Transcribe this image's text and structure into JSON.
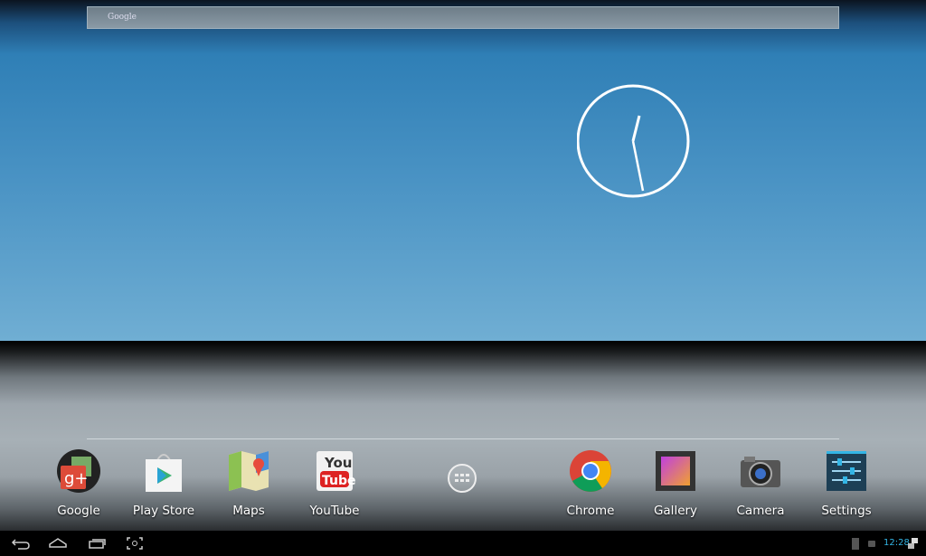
{
  "search": {
    "placeholder": "Google"
  },
  "clock": {
    "type": "analog",
    "time": "12:28"
  },
  "dock": {
    "apps": [
      {
        "label": "Google",
        "icon": "google-plus-icon"
      },
      {
        "label": "Play Store",
        "icon": "play-store-icon"
      },
      {
        "label": "Maps",
        "icon": "maps-icon"
      },
      {
        "label": "YouTube",
        "icon": "youtube-icon"
      },
      {
        "label": "",
        "icon": "all-apps-icon"
      },
      {
        "label": "Chrome",
        "icon": "chrome-icon"
      },
      {
        "label": "Gallery",
        "icon": "gallery-icon"
      },
      {
        "label": "Camera",
        "icon": "camera-icon"
      },
      {
        "label": "Settings",
        "icon": "settings-icon"
      }
    ],
    "youtube_logo": "You Tube"
  },
  "navbar": {
    "buttons": [
      "back",
      "home",
      "recent-apps",
      "screenshot"
    ]
  },
  "status": {
    "time": "12:28",
    "accent": "#33b5e5"
  }
}
